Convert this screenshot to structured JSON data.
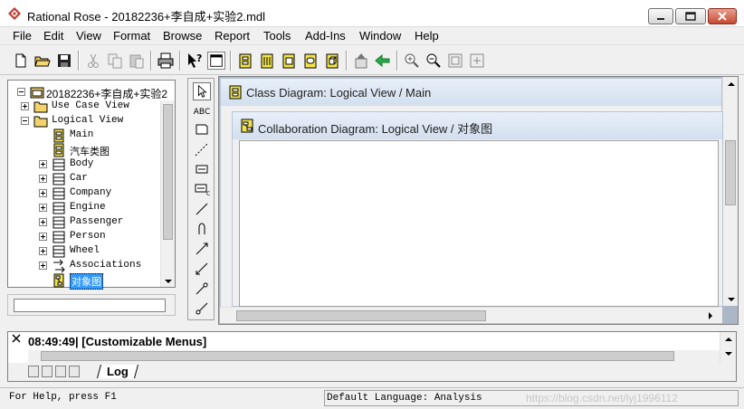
{
  "window": {
    "title": "Rational Rose - 20182236+李自成+实验2.mdl"
  },
  "menu": [
    "File",
    "Edit",
    "View",
    "Format",
    "Browse",
    "Report",
    "Tools",
    "Add-Ins",
    "Window",
    "Help"
  ],
  "browser": {
    "root": "20182236+李自成+实验2",
    "items": [
      {
        "label": "Use Case View",
        "expander": "plus",
        "icon": "folder-icon"
      },
      {
        "label": "Logical View",
        "expander": "minus",
        "icon": "folder-icon"
      },
      {
        "label": "Main",
        "expander": "none",
        "icon": "class-diagram-icon"
      },
      {
        "label": "汽车类图",
        "expander": "none",
        "icon": "class-diagram-icon"
      },
      {
        "label": "Body",
        "expander": "plus",
        "icon": "class-icon"
      },
      {
        "label": "Car",
        "expander": "plus",
        "icon": "class-icon"
      },
      {
        "label": "Company",
        "expander": "plus",
        "icon": "class-icon"
      },
      {
        "label": "Engine",
        "expander": "plus",
        "icon": "class-icon"
      },
      {
        "label": "Passenger",
        "expander": "plus",
        "icon": "class-icon"
      },
      {
        "label": "Person",
        "expander": "plus",
        "icon": "class-icon"
      },
      {
        "label": "Wheel",
        "expander": "plus",
        "icon": "class-icon"
      },
      {
        "label": "Associations",
        "expander": "plus",
        "icon": "associations-icon"
      },
      {
        "label": "对象图",
        "expander": "none",
        "icon": "collaboration-diagram-icon",
        "selected": true
      }
    ]
  },
  "diagrams": {
    "back_title": "Class Diagram: Logical View / Main",
    "front_title": "Collaboration Diagram: Logical View / 对象图"
  },
  "toolbox": {
    "text_tool": "ABC"
  },
  "log": {
    "line": "08:49:49|  [Customizable Menus]",
    "tab": "Log"
  },
  "status": {
    "help": "For Help, press F1",
    "language": "Default Language: Analysis",
    "watermark": "https://blog.csdn.net/lyj1996112"
  },
  "colors": {
    "mdi_background": "#abb6c6",
    "selection": "#3399ff",
    "folder": "#f5d36b",
    "diagram_icon": "#f2e44a"
  }
}
